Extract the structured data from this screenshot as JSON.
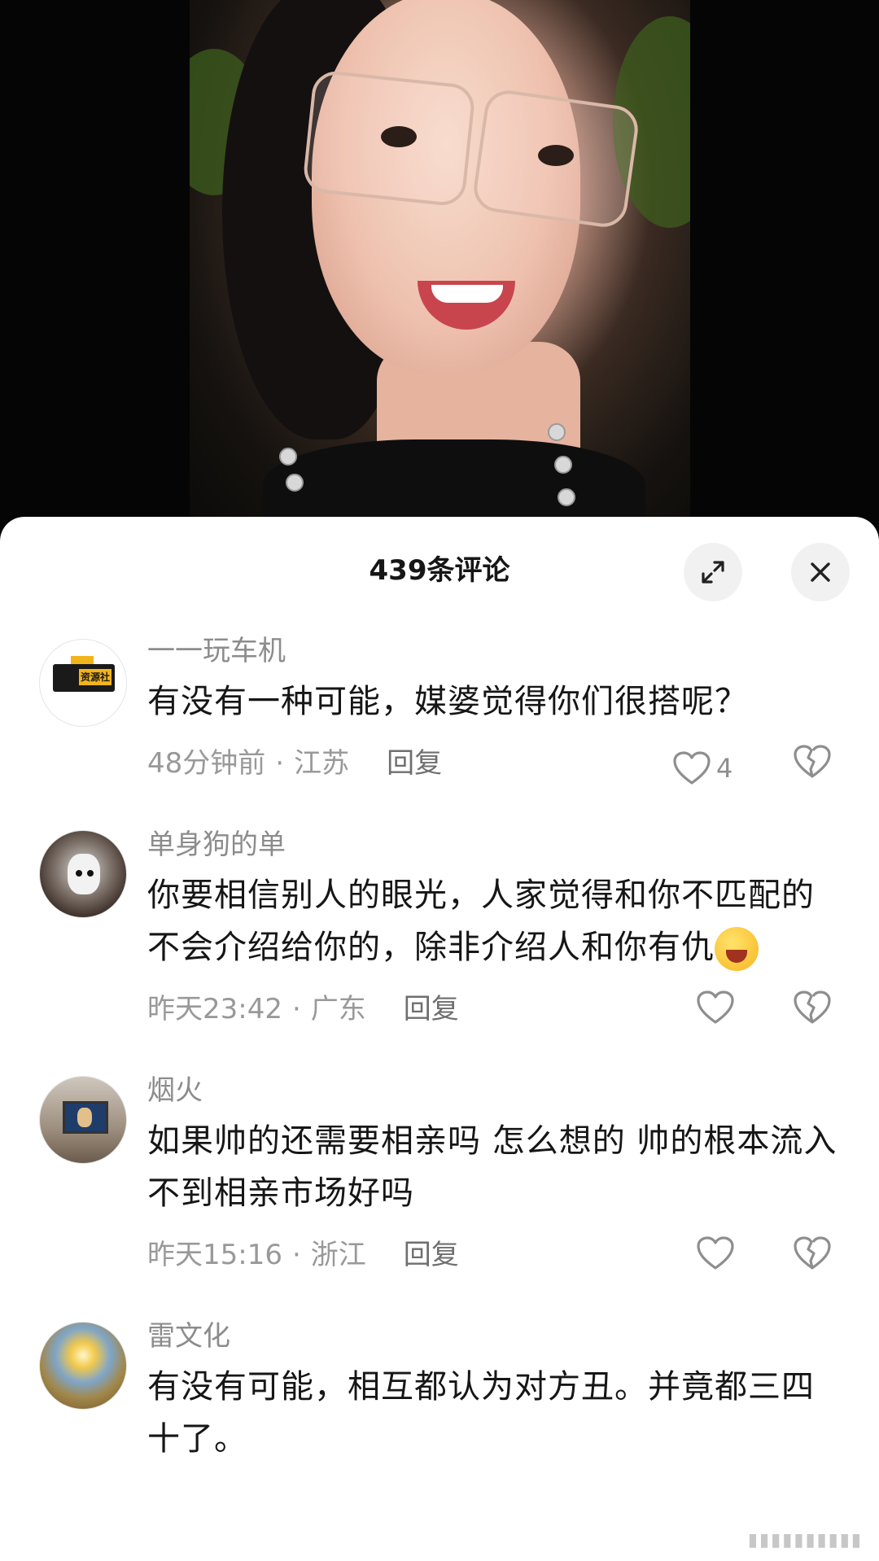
{
  "header": {
    "title": "439条评论"
  },
  "icons": {
    "expand": "expand-icon",
    "close": "close-icon",
    "like": "heart-outline-icon",
    "dislike": "broken-heart-icon",
    "emoji": "laughing-crying-emoji"
  },
  "colors": {
    "sheet_bg": "#ffffff",
    "text_primary": "#161616",
    "text_secondary": "#999999",
    "icon": "#8e8e8e"
  },
  "comments": [
    {
      "user": "一一玩车机",
      "avatar_label": "资源社",
      "text": "有没有一种可能，媒婆觉得你们很搭呢？",
      "time": "48分钟前",
      "location": "江苏",
      "reply": "回复",
      "likes": "4"
    },
    {
      "user": "单身狗的单",
      "avatar_label": "",
      "text": "你要相信别人的眼光，人家觉得和你不匹配的不会介绍给你的，除非介绍人和你有仇",
      "time": "昨天23:42",
      "location": "广东",
      "reply": "回复",
      "likes": ""
    },
    {
      "user": "烟火",
      "avatar_label": "",
      "text": "如果帅的还需要相亲吗 怎么想的 帅的根本流入不到相亲市场好吗",
      "time": "昨天15:16",
      "location": "浙江",
      "reply": "回复",
      "likes": ""
    },
    {
      "user": "雷文化",
      "avatar_label": "",
      "text": "有没有可能，相互都认为对方丑。并竟都三四十了。",
      "time": "",
      "location": "",
      "reply": "",
      "likes": ""
    }
  ]
}
